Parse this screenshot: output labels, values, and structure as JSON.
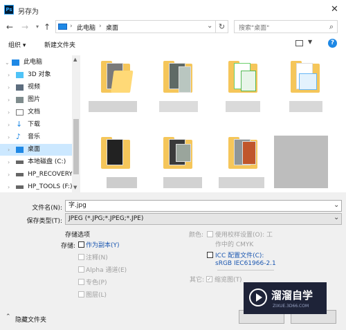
{
  "window": {
    "title": "另存为",
    "app_icon_text": "Ps"
  },
  "nav": {
    "back_icon": "arrow-left-icon",
    "forward_icon": "arrow-right-icon",
    "recent_icon": "chevron-down-icon",
    "up_icon": "arrow-up-icon",
    "breadcrumb": [
      "此电脑",
      "桌面"
    ],
    "search_placeholder": "搜索\"桌面\""
  },
  "toolbar": {
    "organize": "组织 ▾",
    "new_folder": "新建文件夹"
  },
  "sidebar": {
    "items": [
      {
        "label": "此电脑",
        "icon": "pc-icon"
      },
      {
        "label": "3D 对象",
        "icon": "3d-objects-icon"
      },
      {
        "label": "视频",
        "icon": "video-icon"
      },
      {
        "label": "图片",
        "icon": "pictures-icon"
      },
      {
        "label": "文档",
        "icon": "documents-icon"
      },
      {
        "label": "下载",
        "icon": "download-icon"
      },
      {
        "label": "音乐",
        "icon": "music-icon"
      },
      {
        "label": "桌面",
        "icon": "desktop-icon"
      },
      {
        "label": "本地磁盘 (C:)",
        "icon": "drive-icon"
      },
      {
        "label": "HP_RECOVERY",
        "icon": "drive-icon"
      },
      {
        "label": "HP_TOOLS (F:)",
        "icon": "drive-icon"
      }
    ],
    "selected": "桌面"
  },
  "form": {
    "filename_label": "文件名(N):",
    "filename_value": "字.jpg",
    "filetype_label": "保存类型(T):",
    "filetype_value": "JPEG (*.JPG;*.JPEG;*.JPE)"
  },
  "save_options": {
    "section_title": "存储选项",
    "storage_label": "存储:",
    "as_copy": "作为副本(Y)",
    "notes": "注释(N)",
    "alpha": "Alpha 通道(E)",
    "spot": "专色(P)",
    "layers": "图层(L)",
    "color_label": "颜色:",
    "use_proof_1": "使用校样设置(O): 工",
    "use_proof_2": "作中的 CMYK",
    "icc_1": "ICC 配置文件(C):",
    "icc_2": "sRGB IEC61966-2.1",
    "other_label": "其它:",
    "thumbnail": "缩览图(T)"
  },
  "footer": {
    "hide_folders": "隐藏文件夹"
  },
  "watermark": {
    "brand": "溜溜自学",
    "url": "ZIXUE.3D66.COM"
  }
}
